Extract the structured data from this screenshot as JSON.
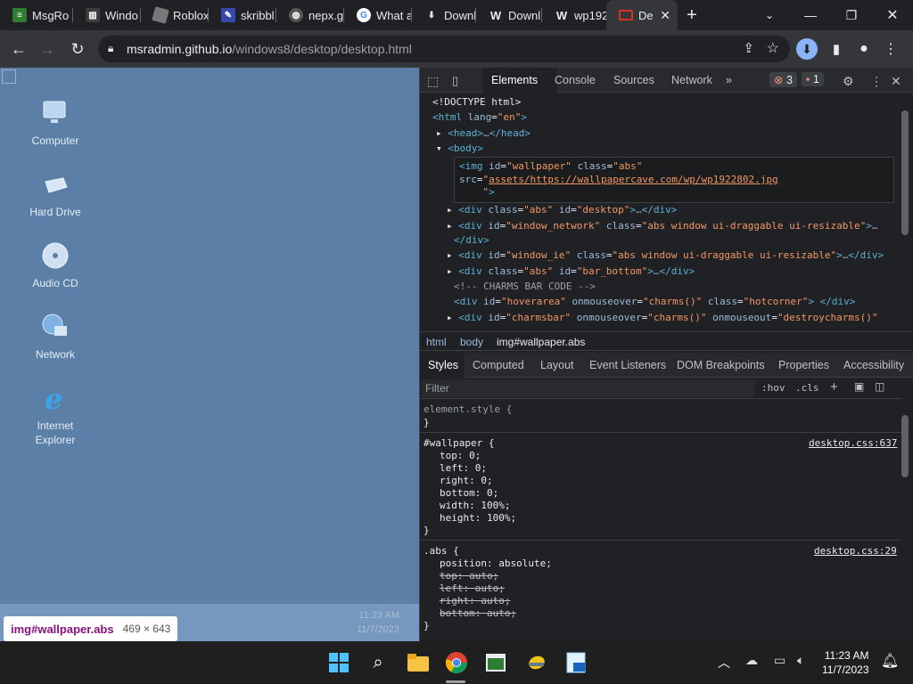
{
  "tabs": [
    {
      "label": "MsgRo",
      "fav_color": "#2e7d32",
      "icon": "msg-icon"
    },
    {
      "label": "Windo",
      "fav_color": "#555",
      "icon": "bars-icon"
    },
    {
      "label": "Roblox",
      "fav_color": "#666",
      "icon": "roblox-icon"
    },
    {
      "label": "skribbl",
      "fav_color": "#3949ab",
      "icon": "pencil-icon"
    },
    {
      "label": "nepx.g",
      "fav_color": "#555",
      "icon": "globe-icon"
    },
    {
      "label": "What a",
      "fav_color": "#ffffff",
      "icon": "google-icon"
    },
    {
      "label": "Downl",
      "fav_color": "#444",
      "icon": "download-icon"
    },
    {
      "label": "Downl",
      "fav_color": "#444",
      "icon": "wordpress-icon"
    },
    {
      "label": "wp192",
      "fav_color": "#444",
      "icon": "wordpress-icon"
    },
    {
      "label": "De",
      "fav_color": "#d93025",
      "icon": "monitor-icon"
    }
  ],
  "url": {
    "host": "msradmin.github.io",
    "path": "/windows8/desktop/desktop.html"
  },
  "desktop_icons": [
    {
      "label1": "Computer",
      "label2": ""
    },
    {
      "label1": "Hard Drive",
      "label2": ""
    },
    {
      "label1": "Audio CD",
      "label2": ""
    },
    {
      "label1": "Network",
      "label2": ""
    },
    {
      "label1": "Internet",
      "label2": "Explorer"
    }
  ],
  "page_clock": {
    "time": "11:23 AM",
    "date": "11/7/2023"
  },
  "tooltip": {
    "selector": "img#wallpaper.abs",
    "size": "469 × 643"
  },
  "devtools": {
    "tabs": [
      "Elements",
      "Console",
      "Sources",
      "Network"
    ],
    "errors": "3",
    "issues": "1",
    "breadcrumb": [
      "html",
      "body",
      "img#wallpaper.abs"
    ],
    "styles_tabs": [
      "Styles",
      "Computed",
      "Layout",
      "Event Listeners",
      "DOM Breakpoints",
      "Properties",
      "Accessibility"
    ],
    "filter_placeholder": "Filter",
    "hov": ":hov",
    "cls": ".cls",
    "rule1": {
      "selector": "element.style {",
      "close": "}"
    },
    "rule2": {
      "selector": "#wallpaper {",
      "source": "desktop.css:637",
      "props": [
        "top: 0;",
        "left: 0;",
        "right: 0;",
        "bottom: 0;",
        "width: 100%;",
        "height: 100%;"
      ]
    },
    "rule3": {
      "selector": ".abs {",
      "source": "desktop.css:29",
      "props": [
        "position: absolute;",
        "top: auto;",
        "left: auto;",
        "right: auto;",
        "bottom: auto;"
      ]
    }
  },
  "taskbar": {
    "time": "11:23 AM",
    "date": "11/7/2023"
  }
}
